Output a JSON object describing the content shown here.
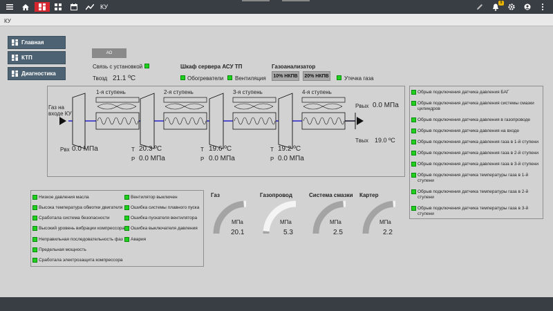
{
  "header": {
    "title": "КУ",
    "notification_count": "9"
  },
  "breadcrumb": "КУ",
  "nav": [
    "Главная",
    "КТП",
    "Диагностика"
  ],
  "ao_button": "АО",
  "connection": {
    "label": "Связь с установкой",
    "tvozd_label": "Твозд",
    "tvozd_value": "21.1 ºС"
  },
  "server_cabinet": {
    "title": "Шкаф сервера АСУ ТП",
    "heaters": "Обогреватели",
    "ventilation": "Вентиляция"
  },
  "gas_analyzer": {
    "title": "Газоанализатор",
    "btn10": "10% НКПВ",
    "btn20": "20% НКПВ",
    "leak": "Утечка газа"
  },
  "scheme": {
    "gas_in": "Газ на\nвходе КУ",
    "stages": [
      "1-я ступень",
      "2-я ступень",
      "3-я ступень",
      "4-я ступень"
    ],
    "pin_label": "Pвх",
    "pin_value": "0.0 МПа",
    "t_label": "T",
    "p_label": "P",
    "stage_t": [
      "20.3 ºС",
      "19.6 ºС",
      "19.2 ºС"
    ],
    "stage_p": [
      "0.0 МПа",
      "0.0 МПа",
      "0.0 МПа"
    ],
    "pout_label": "Pвых",
    "pout_value": "0.0 МПа",
    "tout_label": "Tвых",
    "tout_value": "19.0 ºС"
  },
  "sensor_alarms": [
    "Обрыв подключения датчика давления БАГ",
    "Обрыв подключения датчика давления системы смазки цилиндров",
    "Обрыв подключения датчика давления в газопроводе",
    "Обрыв подключения датчика давления на входе",
    "Обрыв подключения датчика давления газа в 1-й ступени",
    "Обрыв подключения датчика давления газа в 2-й ступени",
    "Обрыв подключения датчика давления газа в 3-й ступени",
    "Обрыв подключения датчика температуры газа в 1-й ступени",
    "Обрыв подключения датчика температуры газа в 2-й ступени",
    "Обрыв подключения датчика температуры газа в 3-й ступени"
  ],
  "alarms_left": [
    "Низкое давления масла",
    "Высока температура обмотки двигателя",
    "Сработала система безопасности",
    "Высокий уровень вибрации компрессора",
    "Неправильная последовательность фаз",
    "Предельная мощность",
    "Сработала электрозащита компрессора"
  ],
  "alarms_right": [
    "Вентилятор выключен",
    "Ошибка системы плавного пуска",
    "Ошибка пускателя вентилятора",
    "Ошибка выключателя давления",
    "Авария"
  ],
  "gauges": [
    {
      "label": "Газ",
      "unit": "МПа",
      "value": "20.1",
      "fill": 0.95
    },
    {
      "label": "Газопровод",
      "unit": "МПа",
      "value": "5.3",
      "fill": 0.05
    },
    {
      "label": "Система смазки",
      "unit": "МПа",
      "value": "2.5",
      "fill": 0.95
    },
    {
      "label": "Картер",
      "unit": "МПа",
      "value": "2.2",
      "fill": 0.95
    }
  ],
  "colors": {
    "topbar": "#393d44",
    "accent": "#d8262f",
    "ok": "#1fd01f",
    "nav": "#4d6373",
    "flow_line": "#0000cc"
  }
}
